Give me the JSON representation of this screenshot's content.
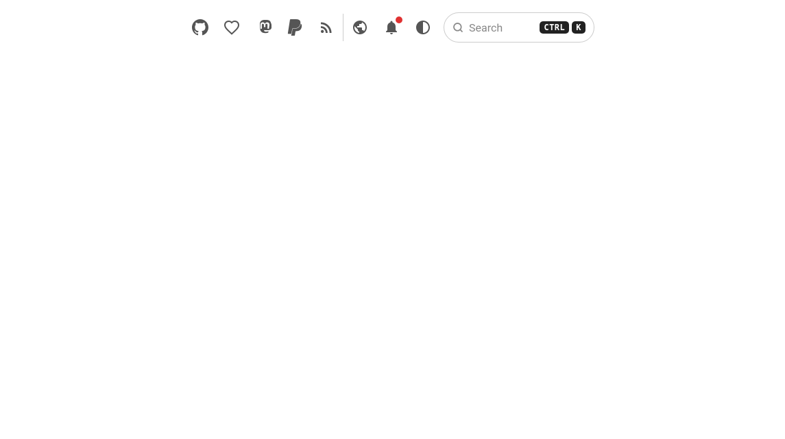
{
  "navbar": {
    "icons_left": [
      {
        "name": "github-icon",
        "label": "GitHub",
        "unicode": ""
      },
      {
        "name": "heart-icon",
        "label": "Sponsor",
        "unicode": "♡"
      },
      {
        "name": "mastodon-icon",
        "label": "Mastodon",
        "unicode": ""
      },
      {
        "name": "paypal-icon",
        "label": "PayPal",
        "unicode": ""
      },
      {
        "name": "rss-icon",
        "label": "RSS",
        "unicode": ""
      }
    ],
    "icons_right": [
      {
        "name": "globe-icon",
        "label": "Website"
      },
      {
        "name": "bell-icon",
        "label": "Notifications",
        "has_badge": true
      },
      {
        "name": "contrast-icon",
        "label": "Theme Toggle"
      }
    ],
    "search": {
      "placeholder": "Search",
      "kbd_ctrl": "CTRL",
      "kbd_k": "K"
    }
  }
}
